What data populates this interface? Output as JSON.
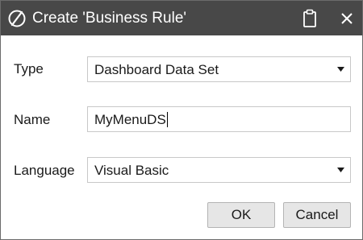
{
  "window": {
    "title": "Create 'Business Rule'",
    "icons": [
      "app-logo-icon",
      "clipboard-icon",
      "close-icon"
    ]
  },
  "form": {
    "type": {
      "label": "Type",
      "value": "Dashboard Data Set"
    },
    "name": {
      "label": "Name",
      "value": "MyMenuDS"
    },
    "language": {
      "label": "Language",
      "value": "Visual Basic"
    }
  },
  "buttons": {
    "ok": "OK",
    "cancel": "Cancel"
  },
  "colors": {
    "titlebar": "#484848",
    "button": "#e6e6e6",
    "field_border": "#c8c8c8"
  }
}
